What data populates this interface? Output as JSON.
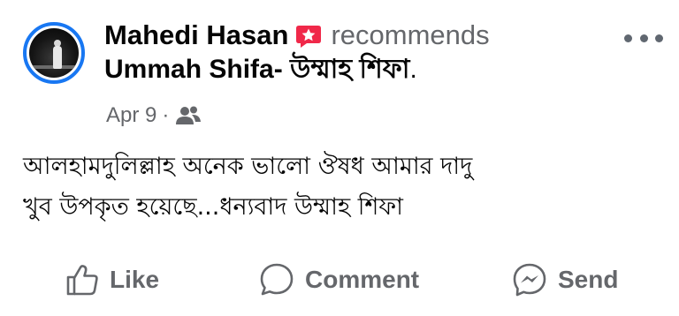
{
  "post": {
    "author": "Mahedi Hasan",
    "recommends": "recommends",
    "page_name": "Ummah Shifa- উম্মাহ শিফা",
    "period": ".",
    "date": "Apr 9",
    "separator": "·",
    "audience_icon": "friends-icon",
    "text_lines": [
      "আলহামদুলিল্লাহ অনেক ভালো ঔষধ আমার দাদু",
      "খুব উপকৃত হয়েছে...ধন্যবাদ উম্মাহ শিফা"
    ]
  },
  "actions": {
    "like": "Like",
    "comment": "Comment",
    "send": "Send"
  },
  "colors": {
    "avatar_ring": "#1877f2",
    "recommend_badge": "#f02849",
    "secondary_text": "#65676b",
    "primary_text": "#050505"
  }
}
